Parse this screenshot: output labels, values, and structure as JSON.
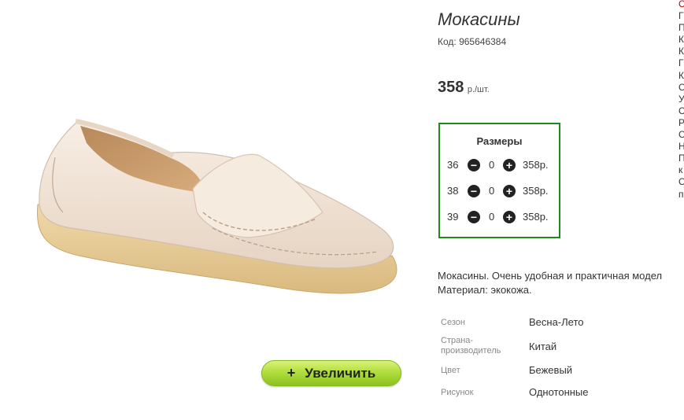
{
  "product": {
    "title": "Мокасины",
    "code_label": "Код: 965646384",
    "price_value": "358",
    "price_unit": "р./шт."
  },
  "sizes": {
    "title": "Размеры",
    "rows": [
      {
        "size": "36",
        "qty": "0",
        "price": "358р."
      },
      {
        "size": "38",
        "qty": "0",
        "price": "358р."
      },
      {
        "size": "39",
        "qty": "0",
        "price": "358р."
      }
    ],
    "minus_icon": "minus-circle-icon",
    "plus_icon": "plus-circle-icon"
  },
  "zoom": {
    "icon": "+",
    "label": "Увеличить",
    "colors": {
      "top": "#d9f27a",
      "bottom": "#8cc21e"
    }
  },
  "description": {
    "line1": "Мокасины. Очень удобная и практичная модел",
    "line2": "Материал: экокожа."
  },
  "attributes": [
    {
      "label": "Сезон",
      "value": "Весна-Лето"
    },
    {
      "label": "Страна-\nпроизводитель",
      "value": "Китай"
    },
    {
      "label": "Цвет",
      "value": "Бежевый"
    },
    {
      "label": "Рисунок",
      "value": "Однотонные"
    }
  ],
  "right_column": {
    "letters": [
      "С",
      "Г",
      "П",
      "К",
      "К",
      "Г",
      "К",
      "С",
      "У",
      "С",
      "Р",
      "С",
      "Н",
      "П",
      "к",
      "С",
      "п"
    ],
    "first_color": "#cc0000"
  },
  "colors": {
    "accent_border": "#1c8a1c",
    "button_green": "#b1de3e"
  }
}
